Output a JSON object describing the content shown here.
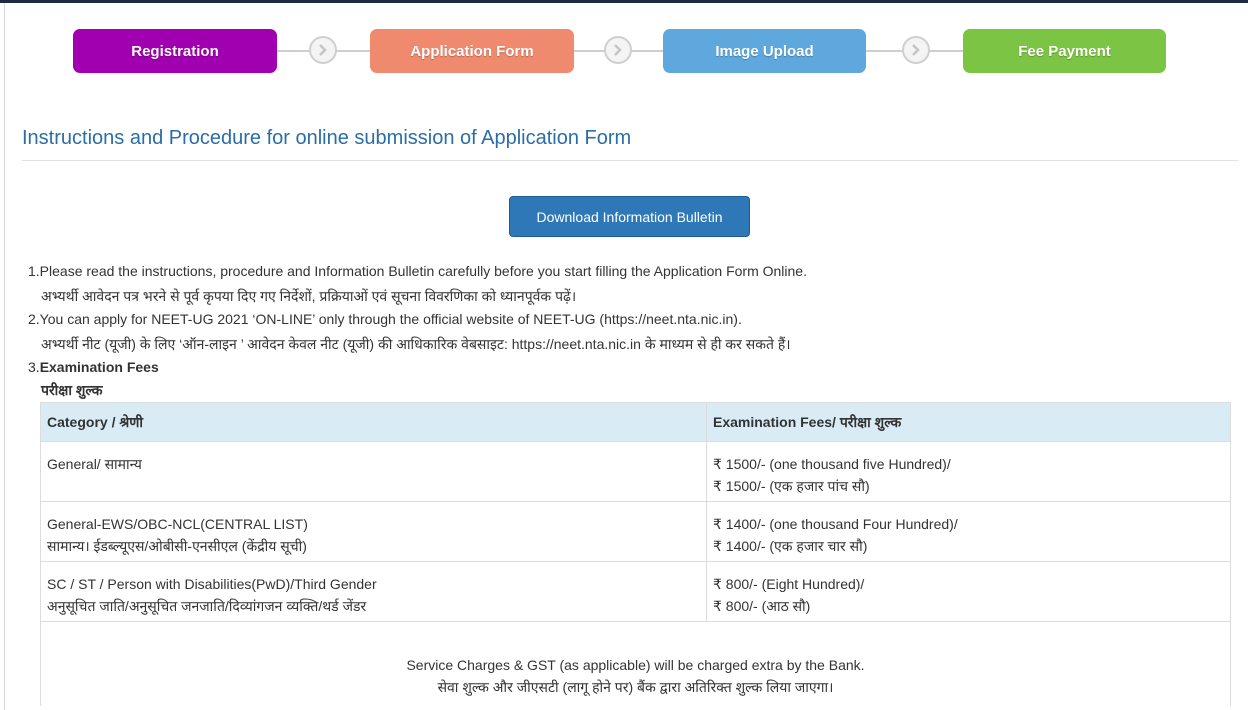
{
  "steps": [
    {
      "label": "Registration"
    },
    {
      "label": "Application Form"
    },
    {
      "label": "Image Upload"
    },
    {
      "label": "Fee Payment"
    }
  ],
  "page_title": "Instructions and Procedure for online submission of Application Form",
  "download_button": "Download Information Bulletin",
  "instructions": {
    "i1_en": "1.Please read the instructions, procedure and Information Bulletin carefully before you start filling the Application Form Online.",
    "i1_hi": "अभ्यर्थी आवेदन पत्र भरने से पूर्व कृपया दिए गए निर्देशों, प्रक्रियाओं एवं सूचना विवरणिका को ध्यानपूर्वक पढ़ें।",
    "i2_en": "2.You can apply for NEET-UG 2021 ‘ON-LINE’ only through the official website of NEET-UG (https://neet.nta.nic.in).",
    "i2_hi": "अभ्यर्थी नीट (यूजी) के लिए ‘ऑन-लाइन ’ आवेदन केवल नीट (यूजी) की आधिकारिक वेबसाइट: https://neet.nta.nic.in के माध्यम से ही कर सकते हैं।",
    "i3_num": "3.",
    "i3_en": "Examination Fees",
    "i3_hi": "परीक्षा शुल्क"
  },
  "fees_table": {
    "headers": {
      "category": "Category / श्रेणी",
      "fees": "Examination Fees/ परीक्षा शुल्क"
    },
    "rows": [
      {
        "cat_en": "General/ सामान्य",
        "cat_hi": "",
        "fee_en": "₹ 1500/- (one thousand five Hundred)/",
        "fee_hi": "₹ 1500/- (एक हजार पांच सौ)"
      },
      {
        "cat_en": "General-EWS/OBC-NCL(CENTRAL LIST)",
        "cat_hi": "सामान्य। ईडब्ल्यूएस/ओबीसी-एनसीएल (केंद्रीय सूची)",
        "fee_en": "₹ 1400/- (one thousand Four Hundred)/",
        "fee_hi": "₹ 1400/- (एक हजार चार सौ)"
      },
      {
        "cat_en": "SC / ST / Person with Disabilities(PwD)/Third Gender",
        "cat_hi": "अनुसूचित जाति/अनुसूचित जनजाति/दिव्यांगजन व्यक्ति/थर्ड जेंडर",
        "fee_en": "₹ 800/- (Eight Hundred)/",
        "fee_hi": "₹ 800/- (आठ सौ)"
      }
    ],
    "note_en": "Service Charges & GST (as applicable) will be charged extra by the Bank.",
    "note_hi": "सेवा शुल्क और जीएसटी (लागू होने पर) बैंक द्वारा अतिरिक्त शुल्क लिया जाएगा।"
  },
  "colors": {
    "step_registration": "#a100b0",
    "step_application": "#f08a6e",
    "step_image": "#5ea8dd",
    "step_fee": "#7cc444",
    "title": "#2a6ea8",
    "button": "#2f78b7",
    "table_header": "#d9ebf5"
  },
  "icons": [
    "chevron-right-circle-icon"
  ]
}
